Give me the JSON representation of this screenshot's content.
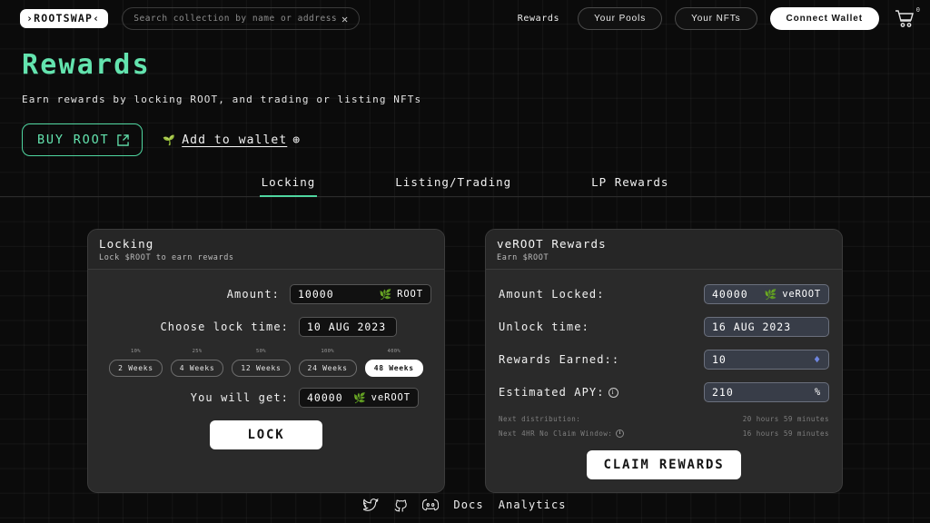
{
  "nav": {
    "logo": "›ROOTSWAP‹",
    "search_placeholder": "Search collection by name or address",
    "search_value": "",
    "clear_icon": "✕",
    "rewards_link": "Rewards",
    "your_pools": "Your Pools",
    "your_nfts": "Your NFTs",
    "connect_wallet": "Connect Wallet",
    "cart_count": "0"
  },
  "hero": {
    "title": "Rewards",
    "subtitle": "Earn rewards by locking ROOT, and trading or listing NFTs",
    "buy_root": "BUY ROOT",
    "external_icon": "↗",
    "add_to_wallet": "Add to wallet",
    "add_icon": "⊕",
    "leaf_icon": "🌱"
  },
  "tabs": [
    {
      "label": "Locking",
      "active": true
    },
    {
      "label": "Listing/Trading",
      "active": false
    },
    {
      "label": "LP Rewards",
      "active": false
    }
  ],
  "locking_card": {
    "title": "Locking",
    "subtitle": "Lock $ROOT to earn rewards",
    "amount_label": "Amount:",
    "amount_value": "10000",
    "amount_suffix": "ROOT",
    "lock_time_label": "Choose lock time:",
    "lock_time_value": "10 AUG 2023",
    "weeks": [
      {
        "label": "2 Weeks",
        "pct": "10%",
        "active": false
      },
      {
        "label": "4 Weeks",
        "pct": "25%",
        "active": false
      },
      {
        "label": "12 Weeks",
        "pct": "50%",
        "active": false
      },
      {
        "label": "24 Weeks",
        "pct": "100%",
        "active": false
      },
      {
        "label": "48 Weeks",
        "pct": "400%",
        "active": true
      }
    ],
    "will_get_label": "You will get:",
    "will_get_value": "40000",
    "will_get_suffix": "veROOT",
    "lock_button": "LOCK"
  },
  "rewards_card": {
    "title": "veROOT Rewards",
    "subtitle": "Earn $ROOT",
    "amount_locked_label": "Amount Locked:",
    "amount_locked_value": "40000",
    "amount_locked_suffix": "veROOT",
    "unlock_time_label": "Unlock time:",
    "unlock_time_value": "16 AUG 2023",
    "rewards_earned_label": "Rewards Earned::",
    "rewards_earned_value": "10",
    "rewards_earned_suffix": "♦",
    "apy_label": "Estimated APY:",
    "apy_value": "210",
    "apy_suffix": "%",
    "info_icon": "i",
    "next_distribution_label": "Next distribution:",
    "next_distribution_value": "20 hours 59 minutes",
    "no_claim_label": "Next 4HR No Claim Window:",
    "no_claim_value": "16 hours 59 minutes",
    "claim_button": "CLAIM REWARDS"
  },
  "footer": {
    "twitter_icon": "twitter-icon",
    "github_icon": "github-icon",
    "discord_icon": "discord-icon",
    "docs": "Docs",
    "analytics": "Analytics"
  },
  "colors": {
    "accent_green": "#63e3ae",
    "bg": "#0b0b0b",
    "card_bg": "#2a2a2a",
    "field_blue": "#383d48"
  }
}
